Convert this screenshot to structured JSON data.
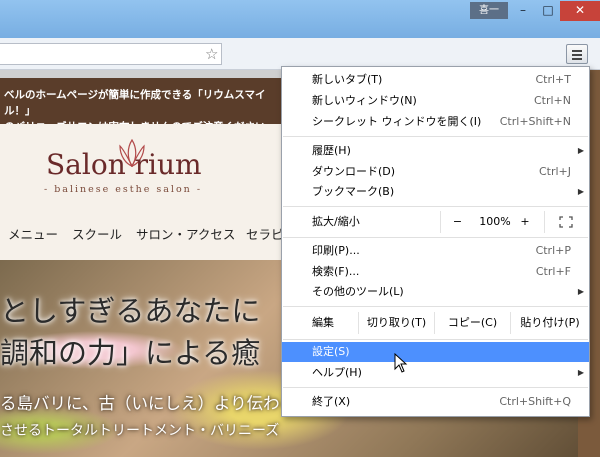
{
  "window": {
    "user_badge": "喜一",
    "minimize": "–",
    "maximize": "□",
    "close": "✕"
  },
  "page": {
    "banner_lines": [
      "ベルのホームページが簡単に作成できる「リウムスマイル！」",
      "のバリニーズサロンは実在しませんのでご注意ください。"
    ],
    "logo": "Salon rium",
    "logo_sub": "- balinese esthe salon -",
    "nav": [
      "メニュー",
      "スクール",
      "サロン・アクセス",
      "セラピ"
    ],
    "hero": [
      "としすぎるあなたに",
      "調和の力」による癒",
      "る島バリに、古（いにしえ）より伝わる",
      "させるトータルトリートメント・バリニーズ"
    ]
  },
  "menu": {
    "items": [
      {
        "label": "新しいタブ(T)",
        "shortcut": "Ctrl+T"
      },
      {
        "label": "新しいウィンドウ(N)",
        "shortcut": "Ctrl+N"
      },
      {
        "label": "シークレット ウィンドウを開く(I)",
        "shortcut": "Ctrl+Shift+N"
      },
      {
        "label": "履歴(H)",
        "shortcut": ""
      },
      {
        "label": "ダウンロード(D)",
        "shortcut": "Ctrl+J"
      },
      {
        "label": "ブックマーク(B)",
        "shortcut": ""
      },
      {
        "label": "印刷(P)...",
        "shortcut": "Ctrl+P"
      },
      {
        "label": "検索(F)...",
        "shortcut": "Ctrl+F"
      },
      {
        "label": "その他のツール(L)",
        "shortcut": ""
      },
      {
        "label": "設定(S)",
        "shortcut": ""
      },
      {
        "label": "ヘルプ(H)",
        "shortcut": ""
      },
      {
        "label": "終了(X)",
        "shortcut": "Ctrl+Shift+Q"
      }
    ],
    "zoom": {
      "label": "拡大/縮小",
      "minus": "−",
      "value": "100%",
      "plus": "+"
    },
    "edit": {
      "label": "編集",
      "cut": "切り取り(T)",
      "copy": "コピー(C)",
      "paste": "貼り付け(P)"
    },
    "highlighted": "設定(S)"
  },
  "colors": {
    "highlight": "#4d90fe",
    "close": "#c7433a",
    "banner": "#5a3d2a"
  }
}
